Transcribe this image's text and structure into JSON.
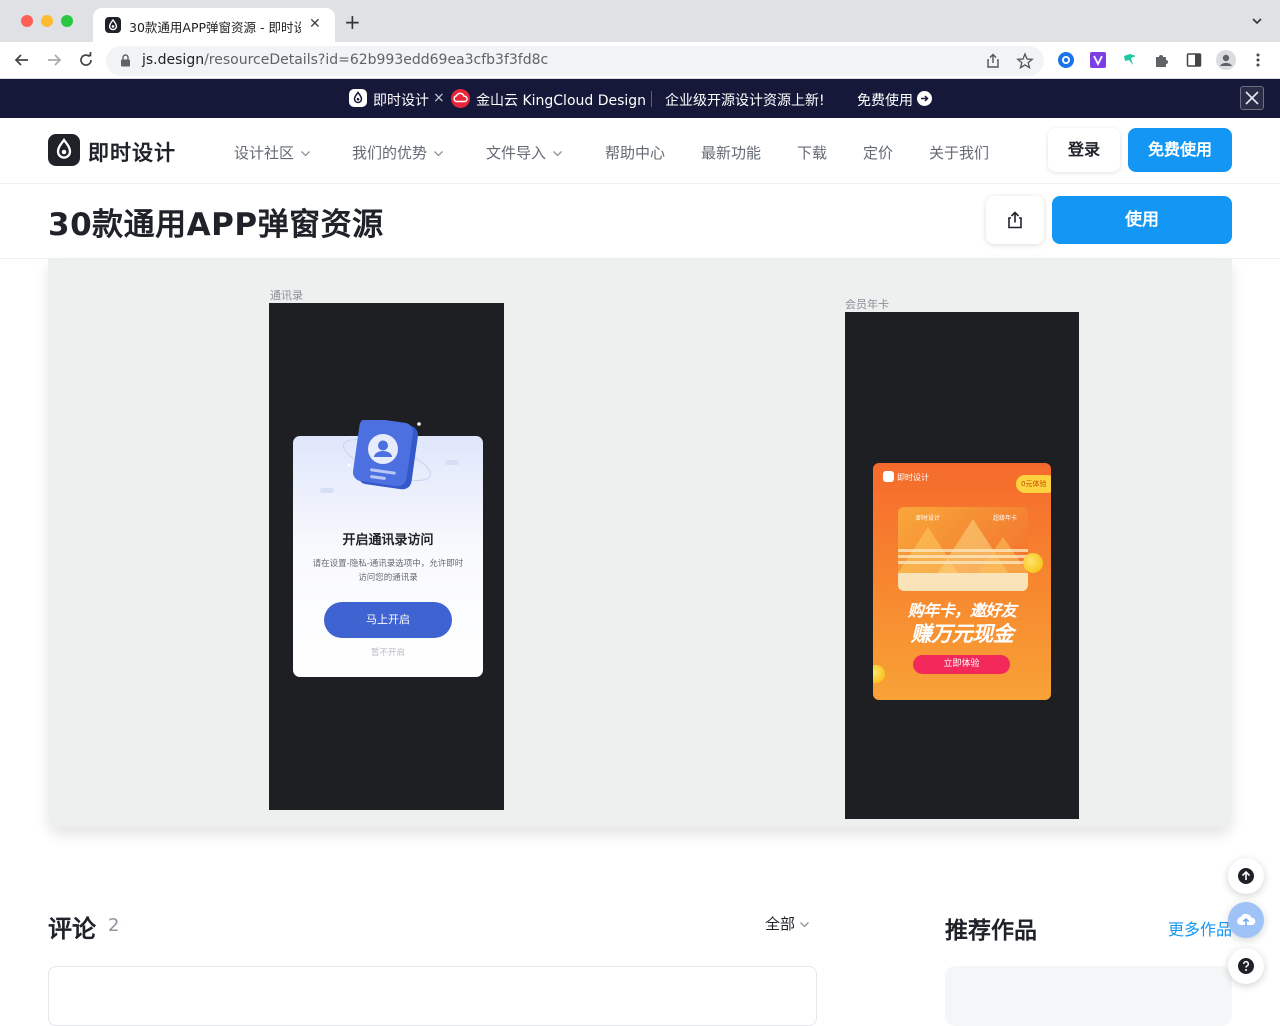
{
  "browser": {
    "tab_title": "30款通用APP弹窗资源 - 即时设计",
    "new_tab": "+",
    "close": "✕",
    "url_host": "js.design",
    "url_path": "/resourceDetails?id=62b993edd69ea3cfb3f3fd8c",
    "colors": {
      "red": "#ff5f57",
      "yellow": "#febc2e",
      "green": "#28c840"
    }
  },
  "banner": {
    "brand_a": "即时设计",
    "times": "×",
    "brand_b": "金山云 KingCloud Design",
    "message": "企业级开源设计资源上新!",
    "cta": "免费使用"
  },
  "header": {
    "logo_text": "即时设计",
    "nav": [
      {
        "label": "设计社区",
        "dropdown": true
      },
      {
        "label": "我们的优势",
        "dropdown": true
      },
      {
        "label": "文件导入",
        "dropdown": true
      },
      {
        "label": "帮助中心",
        "dropdown": false
      },
      {
        "label": "最新功能",
        "dropdown": false
      },
      {
        "label": "下载",
        "dropdown": false
      },
      {
        "label": "定价",
        "dropdown": false
      },
      {
        "label": "关于我们",
        "dropdown": false
      }
    ],
    "login": "登录",
    "free_use": "免费使用"
  },
  "resource": {
    "title": "30款通用APP弹窗资源",
    "use_button": "使用",
    "accent": "#1496f5"
  },
  "preview": {
    "contacts": {
      "frame_label": "通讯录",
      "title": "开启通讯录访问",
      "description": "请在设置-隐私-通讯录选项中，允许即时访问您的通讯录",
      "confirm": "马上开启",
      "cancel": "暂不开启"
    },
    "vip": {
      "frame_label": "会员年卡",
      "brand": "即时设计",
      "tag": "0元体验",
      "card_brand": "即时设计",
      "card_label": "超级年卡",
      "headline_1": "购年卡，邀好友",
      "headline_2": "赚万元现金",
      "button": "立即体验"
    }
  },
  "comments": {
    "title": "评论",
    "count": "2",
    "filter": "全部"
  },
  "recommended": {
    "title": "推荐作品",
    "more": "更多作品"
  }
}
